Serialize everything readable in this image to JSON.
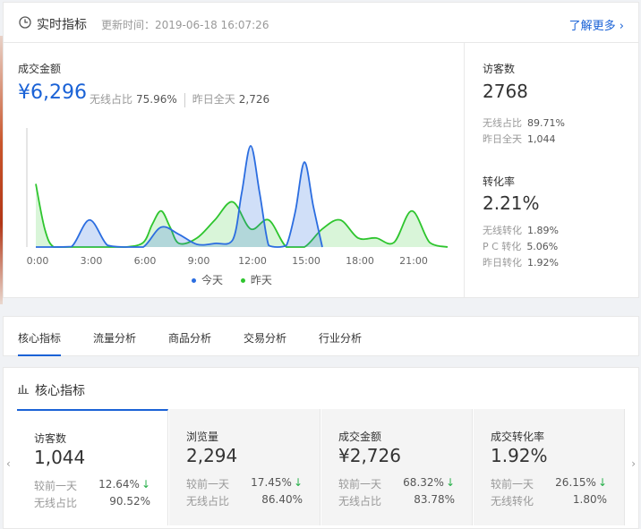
{
  "realtime": {
    "title": "实时指标",
    "update_label": "更新时间：2019-06-18 16:07:26",
    "more_link": "了解更多 ›",
    "gmv": {
      "label": "成交金额",
      "value": "¥6,296",
      "wireless_label": "无线占比",
      "wireless_value": "75.96%",
      "yesterday_label": "昨日全天",
      "yesterday_value": "2,726"
    },
    "visitors": {
      "label": "访客数",
      "value": "2768",
      "wireless_label": "无线占比",
      "wireless_value": "89.71%",
      "yesterday_label": "昨日全天",
      "yesterday_value": "1,044"
    },
    "conversion": {
      "label": "转化率",
      "value": "2.21%",
      "wireless_label": "无线转化",
      "wireless_value": "1.89%",
      "pc_label": "P C 转化",
      "pc_value": "5.06%",
      "yesterday_label": "昨日转化",
      "yesterday_value": "1.92%"
    },
    "legend": {
      "today": "今天",
      "yesterday": "昨天"
    },
    "colors": {
      "today": "#2b6de0",
      "yesterday": "#2ec52e",
      "accent": "#1a62d6"
    }
  },
  "chart_data": {
    "type": "area",
    "x_ticks": [
      "0:00",
      "3:00",
      "6:00",
      "9:00",
      "12:00",
      "15:00",
      "18:00",
      "21:00"
    ],
    "x_range": [
      0,
      23
    ],
    "grid": false,
    "legend_position": "bottom-center",
    "series": [
      {
        "name": "今天",
        "x": [
          0,
          1,
          2,
          3,
          4,
          5,
          6,
          7,
          8,
          9,
          10,
          11,
          11.5,
          12,
          12.5,
          13,
          13.5,
          14,
          14.5,
          15,
          15.5,
          16
        ],
        "y": [
          0,
          0,
          0.5,
          30,
          2,
          0,
          0,
          22,
          14,
          3,
          4,
          8,
          60,
          112,
          60,
          2,
          0,
          2,
          40,
          94,
          45,
          0
        ]
      },
      {
        "name": "昨天",
        "x": [
          0,
          0.5,
          1,
          2,
          3,
          4,
          5,
          6,
          6.5,
          7,
          7.5,
          8,
          9,
          10,
          11,
          12,
          13,
          14,
          15,
          16,
          17,
          18,
          19,
          20,
          21,
          22,
          23
        ],
        "y": [
          70,
          20,
          0,
          0,
          0,
          0,
          0,
          5,
          25,
          40,
          22,
          4,
          10,
          30,
          50,
          20,
          30,
          0,
          0,
          20,
          30,
          10,
          10,
          5,
          40,
          5,
          0
        ]
      }
    ]
  },
  "tabs": [
    {
      "label": "核心指标",
      "active": true
    },
    {
      "label": "流量分析",
      "active": false
    },
    {
      "label": "商品分析",
      "active": false
    },
    {
      "label": "交易分析",
      "active": false
    },
    {
      "label": "行业分析",
      "active": false
    }
  ],
  "core": {
    "title": "核心指标",
    "prev_arrow": "‹",
    "next_arrow": "›",
    "cards": [
      {
        "label": "访客数",
        "value": "1,044",
        "row1_label": "较前一天",
        "row1_value": "12.64%",
        "row2_label": "无线占比",
        "row2_value": "90.52%",
        "trend": "down",
        "active": true
      },
      {
        "label": "浏览量",
        "value": "2,294",
        "row1_label": "较前一天",
        "row1_value": "17.45%",
        "row2_label": "无线占比",
        "row2_value": "86.40%",
        "trend": "down",
        "active": false
      },
      {
        "label": "成交金额",
        "value": "¥2,726",
        "row1_label": "较前一天",
        "row1_value": "68.32%",
        "row2_label": "无线占比",
        "row2_value": "83.78%",
        "trend": "down",
        "active": false
      },
      {
        "label": "成交转化率",
        "value": "1.92%",
        "row1_label": "较前一天",
        "row1_value": "26.15%",
        "row2_label": "无线转化",
        "row2_value": "1.80%",
        "trend": "down",
        "active": false
      }
    ]
  }
}
